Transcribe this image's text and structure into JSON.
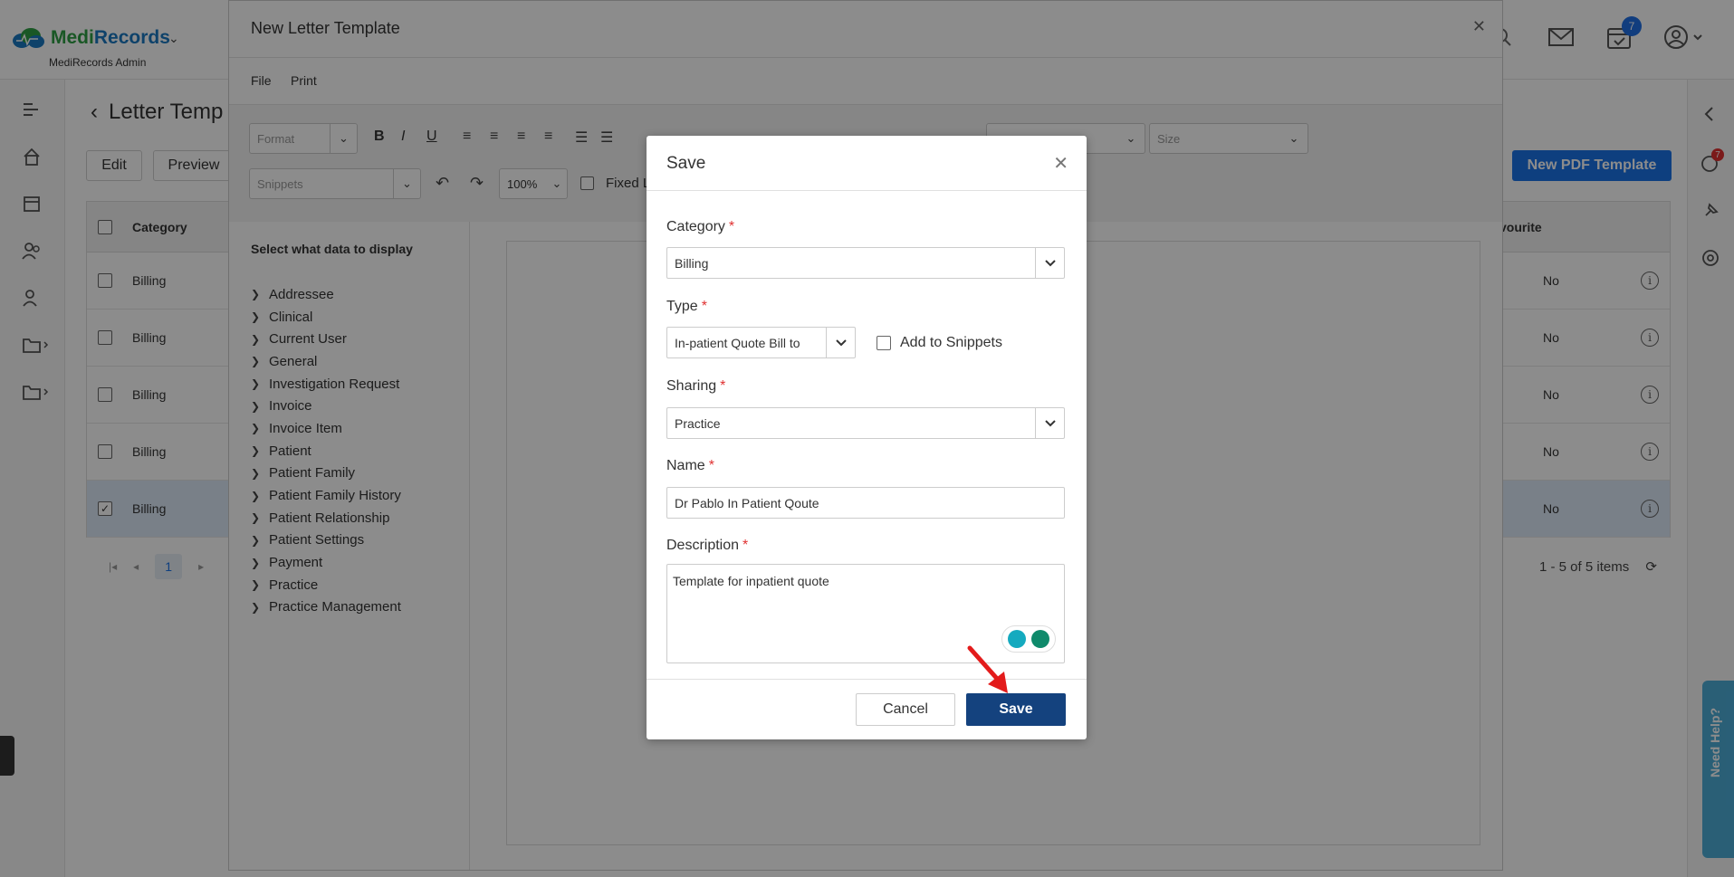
{
  "app": {
    "brand_medi": "Medi",
    "brand_records": "Records",
    "subtitle": "MediRecords Admin",
    "calendar_badge": "7",
    "chat_badge": "7"
  },
  "page": {
    "title": "Letter Temp",
    "edit_label": "Edit",
    "preview_label": "Preview",
    "new_pdf_label": "New PDF Template",
    "columns": {
      "category": "Category",
      "favourite": "vourite"
    },
    "rows": [
      {
        "category": "Billing",
        "favourite": "No",
        "checked": false
      },
      {
        "category": "Billing",
        "favourite": "No",
        "checked": false
      },
      {
        "category": "Billing",
        "favourite": "No",
        "checked": false
      },
      {
        "category": "Billing",
        "favourite": "No",
        "checked": false
      },
      {
        "category": "Billing",
        "favourite": "No",
        "checked": true
      }
    ],
    "pager_page": "1",
    "items_info": "1 - 5 of 5 items"
  },
  "letter_modal": {
    "title": "New Letter Template",
    "menu": {
      "file": "File",
      "print": "Print"
    },
    "toolbar": {
      "format_placeholder": "Format",
      "snippets_placeholder": "Snippets",
      "zoom": "100%",
      "size_placeholder": "Size",
      "fixed_label": "Fixed L",
      "bold": "B",
      "italic": "I",
      "underline": "U"
    },
    "side_heading": "Select what data to display",
    "tree": [
      "Addressee",
      "Clinical",
      "Current User",
      "General",
      "Investigation Request",
      "Invoice",
      "Invoice Item",
      "Patient",
      "Patient Family",
      "Patient Family History",
      "Patient Relationship",
      "Patient Settings",
      "Payment",
      "Practice",
      "Practice Management"
    ]
  },
  "save_dialog": {
    "title": "Save",
    "category_label": "Category",
    "category_value": "Billing",
    "type_label": "Type",
    "type_value": "In-patient Quote Bill to",
    "add_snippets_label": "Add to Snippets",
    "sharing_label": "Sharing",
    "sharing_value": "Practice",
    "name_label": "Name",
    "name_value": "Dr Pablo In Patient Qoute",
    "description_label": "Description",
    "description_value": "Template for inpatient quote",
    "cancel_label": "Cancel",
    "save_label": "Save",
    "required_mark": "*"
  },
  "need_help": "Need Help?",
  "colors": {
    "primary_button": "#14427e",
    "accent_blue": "#1a73e8",
    "required": "#e03131",
    "annotation_arrow": "#e31b1b"
  }
}
